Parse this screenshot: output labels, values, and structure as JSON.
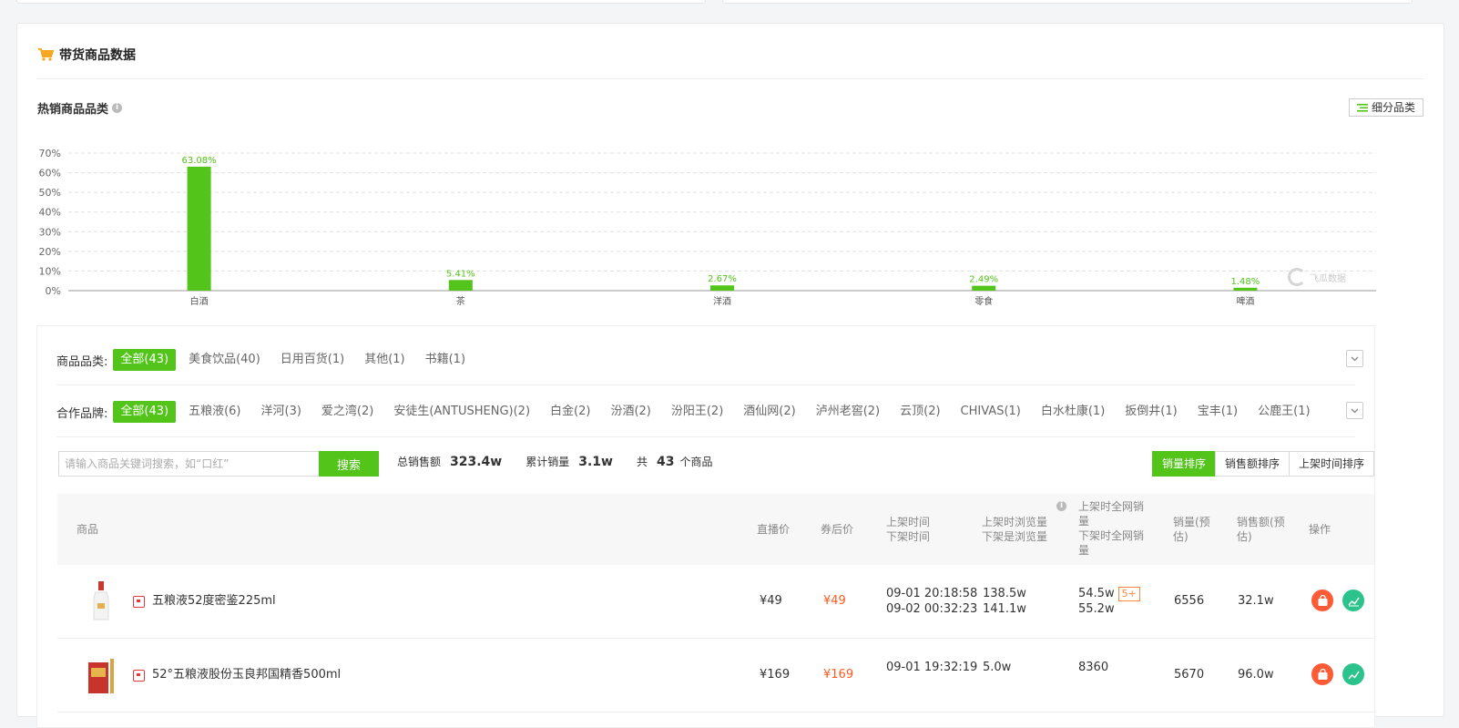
{
  "section": {
    "title": "带货商品数据"
  },
  "hot_categories": {
    "title": "热销商品品类",
    "breakdown_button": "细分品类"
  },
  "chart_data": {
    "type": "bar",
    "categories": [
      "白酒",
      "茶",
      "洋酒",
      "零食",
      "啤酒"
    ],
    "values": [
      63.08,
      5.41,
      2.67,
      2.49,
      1.48
    ],
    "data_labels": [
      "63.08%",
      "5.41%",
      "2.67%",
      "2.49%",
      "1.48%"
    ],
    "y_ticks": [
      "0%",
      "10%",
      "20%",
      "30%",
      "40%",
      "50%",
      "60%",
      "70%"
    ],
    "ylim": [
      0,
      70
    ],
    "grid": true,
    "bar_color": "#52c41a",
    "label_color": "#52c41a"
  },
  "watermark": {
    "text": "飞瓜数据"
  },
  "filters": {
    "category": {
      "label": "商品品类:",
      "options": [
        "全部(43)",
        "美食饮品(40)",
        "日用百货(1)",
        "其他(1)",
        "书籍(1)"
      ],
      "active": 0
    },
    "brand": {
      "label": "合作品牌:",
      "options": [
        "全部(43)",
        "五粮液(6)",
        "洋河(3)",
        "爱之湾(2)",
        "安徒生(ANTUSHENG)(2)",
        "白金(2)",
        "汾酒(2)",
        "汾阳王(2)",
        "酒仙网(2)",
        "泸州老窖(2)",
        "云顶(2)",
        "CHIVAS(1)",
        "白水杜康(1)",
        "扳倒井(1)",
        "宝丰(1)",
        "公鹿王(1)"
      ],
      "active": 0
    }
  },
  "search": {
    "placeholder": "请输入商品关键词搜索，如“口红”",
    "button": "搜索"
  },
  "stats": {
    "total_sales_label": "总销售额",
    "total_sales": "323.4w",
    "cumulative_label": "累计销量",
    "cumulative": "3.1w",
    "count_prefix": "共",
    "count": "43",
    "count_suffix": "个商品"
  },
  "sort": {
    "options": [
      "销量排序",
      "销售额排序",
      "上架时间排序"
    ],
    "active": 0
  },
  "table": {
    "headers": {
      "product": "商品",
      "live_price": "直播价",
      "coupon_price": "券后价",
      "time_on": "上架时间",
      "time_off": "下架时间",
      "views_on": "上架时浏览量",
      "views_off": "下架是浏览量",
      "net_sales_on": [
        "上架时全网销",
        "量"
      ],
      "net_sales_off": [
        "下架时全网销",
        "量"
      ],
      "sales_est": [
        "销量(预",
        "估)"
      ],
      "revenue_est": [
        "销售额(预",
        "估)"
      ],
      "ops": "操作"
    },
    "rows": [
      {
        "name": "五粮液52度密鉴225ml",
        "live_price": "¥49",
        "coupon_price": "¥49",
        "time_on": "09-01 20:18:58",
        "time_off": "09-02 00:32:23",
        "views_on": "138.5w",
        "views_off": "141.1w",
        "net_on": "54.5w",
        "net_on_badge": "5+",
        "net_off": "55.2w",
        "sales": "6556",
        "revenue": "32.1w"
      },
      {
        "name": "52°五粮液股份玉良邦国精香500ml",
        "live_price": "¥169",
        "coupon_price": "¥169",
        "time_on": "09-01 19:32:19",
        "time_off": "",
        "views_on": "5.0w",
        "views_off": "",
        "net_on": "8360",
        "net_on_badge": "",
        "net_off": "",
        "sales": "5670",
        "revenue": "96.0w"
      }
    ]
  },
  "colors": {
    "accent": "#52c41a",
    "price": "#ff5a1f",
    "op_red": "#ff5a36",
    "op_green": "#2bc38b"
  }
}
